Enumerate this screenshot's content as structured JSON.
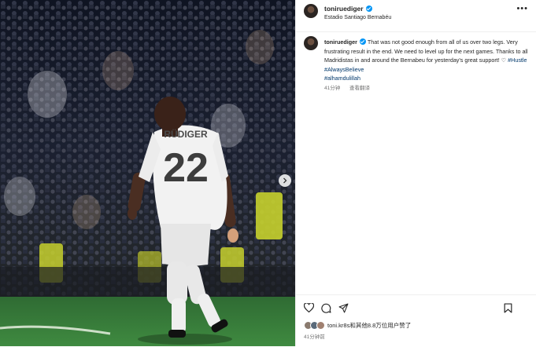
{
  "post": {
    "username": "toniruediger",
    "location": "Estadio Santiago Bernabéu",
    "caption_prefix": "That was not good enough from all of us over two legs. Very frustrating result in the end. We need to level up for the next games. Thanks to all Madridistas in and around the Bernabeu for yesterday's great support! ♡ ",
    "hashtags": [
      "#Hustle",
      "#AlwaysBelieve",
      "#alhamdulillah"
    ],
    "time_ago": "41分钟",
    "see_translation": "查看翻译",
    "likes_text": "toni.kr8s和其他8.8万位用户赞了",
    "time_bottom": "41分钟前",
    "player_name": "RÜDIGER",
    "player_number": "22"
  },
  "icons": {
    "verified": "verified-badge-icon",
    "more": "more-options-icon",
    "like": "heart-icon",
    "comment": "comment-bubble-icon",
    "share": "share-plane-icon",
    "save": "bookmark-icon",
    "next": "chevron-right-icon"
  },
  "colors": {
    "verified_blue": "#0095f6",
    "hashtag": "#00376b",
    "muted": "#737373",
    "text": "#262626"
  }
}
